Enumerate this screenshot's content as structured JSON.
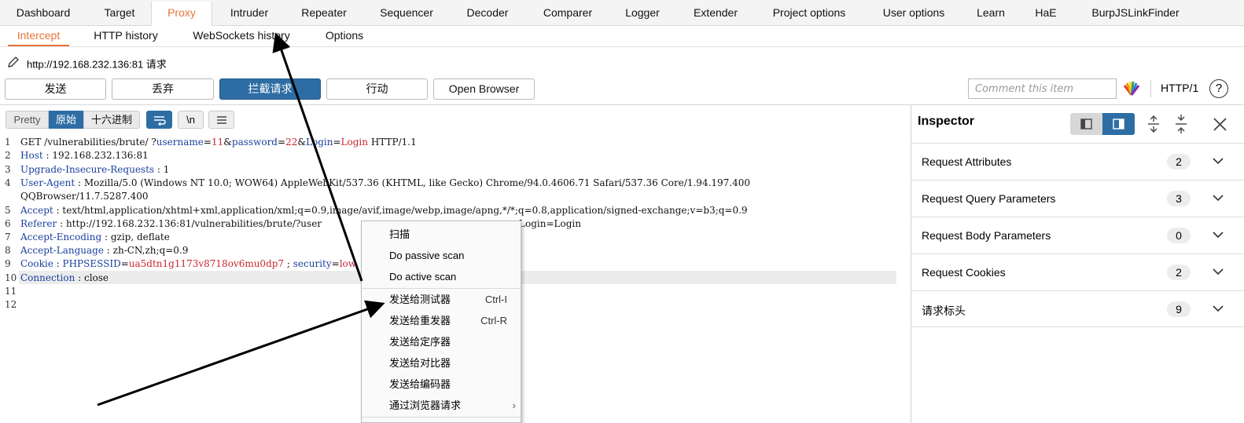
{
  "main_tabs": [
    "Dashboard",
    "Target",
    "Proxy",
    "Intruder",
    "Repeater",
    "Sequencer",
    "Decoder",
    "Comparer",
    "Logger",
    "Extender",
    "Project options",
    "User options",
    "Learn",
    "HaE",
    "BurpJSLinkFinder"
  ],
  "sub_tabs": [
    "Intercept",
    "HTTP history",
    "WebSockets history",
    "Options"
  ],
  "request_line": "http://192.168.232.136:81 请求",
  "toolbar": {
    "forward": "发送",
    "drop": "丢弃",
    "intercept": "拦截请求",
    "action": "行动",
    "open_browser": "Open Browser",
    "comment_placeholder": "Comment this item",
    "http_version": "HTTP/1",
    "help": "?"
  },
  "view_modes": {
    "pretty": "Pretty",
    "raw": "原始",
    "hex": "十六进制",
    "newline": "\\n"
  },
  "editor_lines": {
    "n1": "1",
    "n2": "2",
    "n3": "3",
    "n4": "4",
    "n5": "5",
    "n6": "6",
    "n7": "7",
    "n8": "8",
    "n9": "9",
    "n10": "10",
    "n11": "11",
    "n12": "12",
    "l1_method": "GET /vulnerabilities/brute/ ?",
    "l1_k1": "username",
    "l1_eq1": "=",
    "l1_v1": "11",
    "l1_amp1": "&",
    "l1_k2": "password",
    "l1_eq2": "=",
    "l1_v2": "22",
    "l1_amp2": "&",
    "l1_k3": "Login",
    "l1_eq3": "=",
    "l1_v3": "Login",
    "l1_ver": " HTTP/1.1",
    "l2_k": "Host",
    "l2_v": " : 192.168.232.136:81",
    "l3_k": "Upgrade-Insecure-Requests",
    "l3_v": " : 1",
    "l4_k": "User-Agent",
    "l4_v": " : Mozilla/5.0 (Windows NT 10.0; WOW64) AppleWebKit/537.36 (KHTML, like Gecko) Chrome/94.0.4606.71 Safari/537.36 Core/1.94.197.400",
    "l4_cont": "QQBrowser/11.7.5287.400",
    "l5_k": "Accept",
    "l5_v": " : text/html,application/xhtml+xml,application/xml;q=0.9,image/avif,image/webp,image/apng,*/*;q=0.8,application/signed-exchange;v=b3;q=0.9",
    "l6_k": "Referer",
    "l6_v": " : http://192.168.232.136:81/vulnerabilities/brute/?user",
    "l6_tail": "Login=Login",
    "l7_k": "Accept-Encoding",
    "l7_v": " : gzip, deflate",
    "l8_k": "Accept-Language",
    "l8_v": " : zh-CN,zh;q=0.9",
    "l9_k": "Cookie",
    "l9_sep": " : ",
    "l9_ck": "PHPSESSID",
    "l9_eq": "=",
    "l9_cv": "ua5dtn1g1173v8718ov6mu0dp7",
    "l9_semi": " ; ",
    "l9_ck2": "security",
    "l9_eq2": "=",
    "l9_cv2": "low",
    "l10_k": "Connection",
    "l10_v": " : close"
  },
  "inspector": {
    "title": "Inspector",
    "sections": [
      {
        "label": "Request Attributes",
        "count": "2"
      },
      {
        "label": "Request Query Parameters",
        "count": "3"
      },
      {
        "label": "Request Body Parameters",
        "count": "0"
      },
      {
        "label": "Request Cookies",
        "count": "2"
      },
      {
        "label": "请求标头",
        "count": "9"
      }
    ]
  },
  "context_menu": {
    "items": [
      {
        "label": "扫描",
        "shortcut": ""
      },
      {
        "label": "Do passive scan",
        "shortcut": ""
      },
      {
        "label": "Do active scan",
        "shortcut": ""
      },
      {
        "label": "发送给测试器",
        "shortcut": "Ctrl-I"
      },
      {
        "label": "发送给重发器",
        "shortcut": "Ctrl-R"
      },
      {
        "label": "发送给定序器",
        "shortcut": ""
      },
      {
        "label": "发送给对比器",
        "shortcut": ""
      },
      {
        "label": "发送给编码器",
        "shortcut": ""
      },
      {
        "label": "通过浏览器请求",
        "shortcut": ""
      }
    ]
  },
  "colors": {
    "accent_orange": "#e8743b",
    "primary_blue": "#2e6da4",
    "key_blue": "#1a3f9c",
    "value_red": "#c6272e"
  }
}
